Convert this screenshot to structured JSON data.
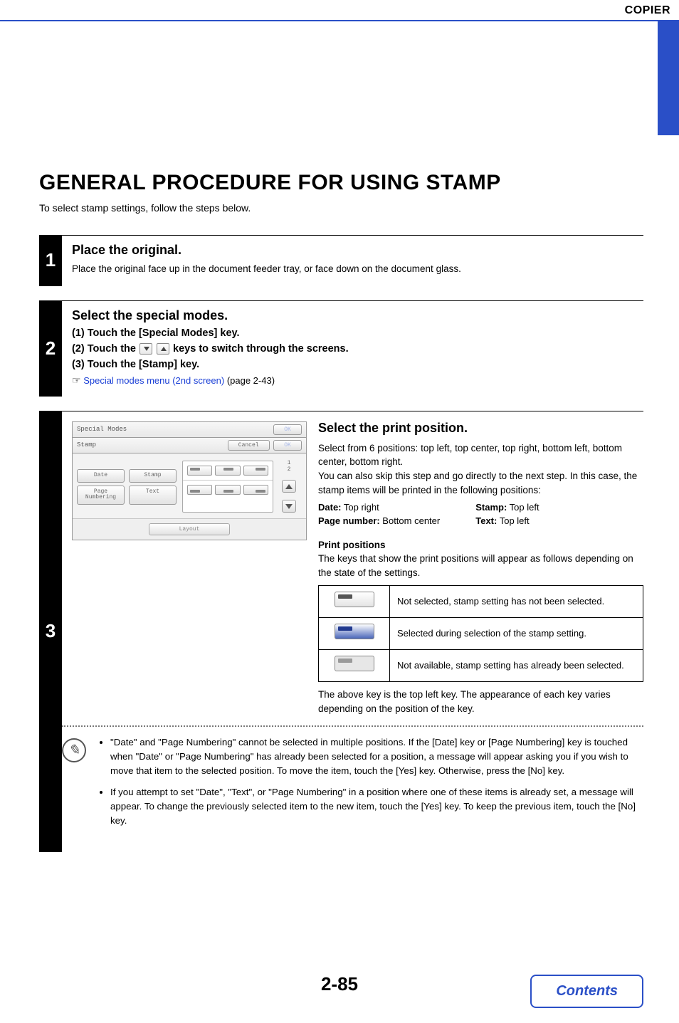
{
  "header": {
    "section": "COPIER"
  },
  "title": "GENERAL PROCEDURE FOR USING STAMP",
  "intro": "To select stamp settings, follow the steps below.",
  "step1": {
    "num": "1",
    "title": "Place the original.",
    "text": "Place the original face up in the document feeder tray, or face down on the document glass."
  },
  "step2": {
    "num": "2",
    "title": "Select the special modes.",
    "s1": "(1)   Touch the [Special Modes] key.",
    "s2a": "(2)   Touch the ",
    "s2b": " keys to switch through the screens.",
    "s3": "(3)   Touch the [Stamp] key.",
    "ref_hand": "☞",
    "ref_link": "Special modes menu (2nd screen)",
    "ref_page": " (page 2-43)"
  },
  "step3": {
    "num": "3",
    "panel": {
      "header": "Special Modes",
      "ok": "OK",
      "stamp": "Stamp",
      "cancel": "Cancel",
      "modes": {
        "date": "Date",
        "stampb": "Stamp",
        "pageno": "Page\nNumbering",
        "text": "Text"
      },
      "pg": "1\n2",
      "layout": "Layout"
    },
    "desc": {
      "title": "Select the print position.",
      "p1": "Select from 6 positions: top left, top center, top right, bottom left, bottom center, bottom right.",
      "p2": "You can also skip this step and go directly to the next step. In this case, the stamp items will be printed in the following positions:",
      "def_date_l": "Date:",
      "def_date_v": " Top right",
      "def_stamp_l": "Stamp:",
      "def_stamp_v": " Top left",
      "def_page_l": "Page number:",
      "def_page_v": " Bottom center",
      "def_text_l": "Text:",
      "def_text_v": " Top left",
      "pp_h": "Print positions",
      "pp_t": "The keys that show the print positions will appear as follows depending on the state of the settings.",
      "state1": "Not selected, stamp setting has not been selected.",
      "state2": "Selected during selection of the stamp setting.",
      "state3": "Not available, stamp setting has already been selected.",
      "after": "The above key is the top left key. The appearance of each key varies depending on the position of the key."
    },
    "notes": {
      "n1": "\"Date\" and \"Page Numbering\" cannot be selected in multiple positions. If the [Date] key or [Page Numbering] key is touched when \"Date\" or \"Page Numbering\" has already been selected for a position, a message will appear asking you if you wish to move that item to the selected position. To move the item, touch the [Yes] key. Otherwise, press the [No] key.",
      "n2": "If you attempt to set \"Date\", \"Text\", or \"Page Numbering\" in a position where one of these items is already set, a message will appear. To change the previously selected item to the new item, touch the [Yes] key. To keep the previous item, touch the [No] key."
    }
  },
  "footer": {
    "page": "2-85",
    "contents": "Contents"
  }
}
